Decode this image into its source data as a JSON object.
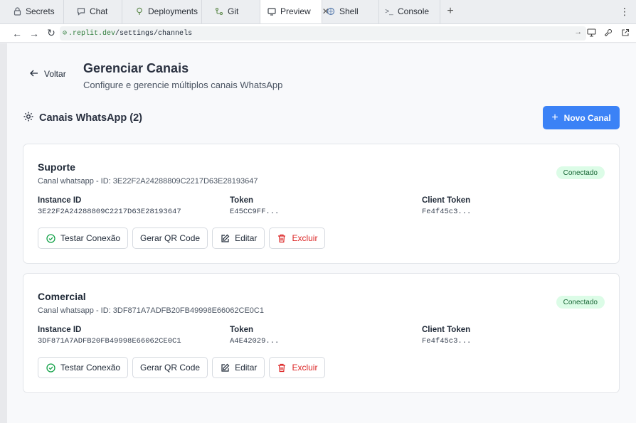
{
  "browser": {
    "tabs": [
      {
        "label": "Secrets",
        "icon": "lock-icon"
      },
      {
        "label": "Chat",
        "icon": "chat-icon"
      },
      {
        "label": "Deployments",
        "icon": "deploy-icon"
      },
      {
        "label": "Git",
        "icon": "git-icon"
      },
      {
        "label": "Preview",
        "icon": "preview-icon",
        "active": true
      },
      {
        "label": "Shell",
        "icon": "shell-icon"
      },
      {
        "label": "Console",
        "icon": "console-icon"
      }
    ],
    "url_host": ".replit.dev",
    "url_path": "/settings/channels"
  },
  "header": {
    "back_label": "Voltar",
    "title": "Gerenciar Canais",
    "subtitle": "Configure e gerencie múltiplos canais WhatsApp"
  },
  "section": {
    "title": "Canais WhatsApp (2)",
    "new_button": "Novo Canal"
  },
  "labels": {
    "instance_id": "Instance ID",
    "token": "Token",
    "client_token": "Client Token",
    "test": "Testar Conexão",
    "qr": "Gerar QR Code",
    "edit": "Editar",
    "delete": "Excluir"
  },
  "channels": [
    {
      "name": "Suporte",
      "desc": "Canal whatsapp - ID: 3E22F2A24288809C2217D63E28193647",
      "status": "Conectado",
      "instance_id": "3E22F2A24288809C2217D63E28193647",
      "token": "E45CC9FF...",
      "client_token": "Fe4f45c3..."
    },
    {
      "name": "Comercial",
      "desc": "Canal whatsapp - ID: 3DF871A7ADFB20FB49998E66062CE0C1",
      "status": "Conectado",
      "instance_id": "3DF871A7ADFB20FB49998E66062CE0C1",
      "token": "A4E42029...",
      "client_token": "Fe4f45c3..."
    }
  ],
  "colors": {
    "primary": "#3b82f6",
    "success_bg": "#dcfce7",
    "success_text": "#166534",
    "danger": "#dc2626"
  }
}
